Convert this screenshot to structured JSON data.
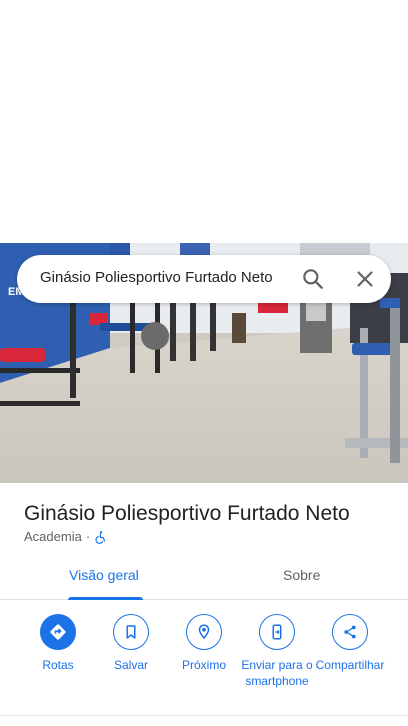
{
  "search": {
    "query": "Ginásio Poliesportivo Furtado Neto"
  },
  "place": {
    "title": "Ginásio Poliesportivo Furtado Neto",
    "category": "Academia",
    "separator": "·",
    "accessibility_icon": "wheelchair-icon"
  },
  "photo": {
    "wall_text": "EM PATRONA"
  },
  "tabs": [
    {
      "label": "Visão geral",
      "active": true
    },
    {
      "label": "Sobre",
      "active": false
    }
  ],
  "actions": [
    {
      "label": "Rotas",
      "icon": "directions-icon"
    },
    {
      "label": "Salvar",
      "icon": "bookmark-icon"
    },
    {
      "label": "Próximo",
      "icon": "nearby-icon"
    },
    {
      "label": "Enviar para o smartphone",
      "icon": "send-to-phone-icon"
    },
    {
      "label": "Compartilhar",
      "icon": "share-icon"
    }
  ],
  "colors": {
    "accent": "#1a73e8",
    "text": "#202124",
    "secondary": "#5f6368"
  }
}
